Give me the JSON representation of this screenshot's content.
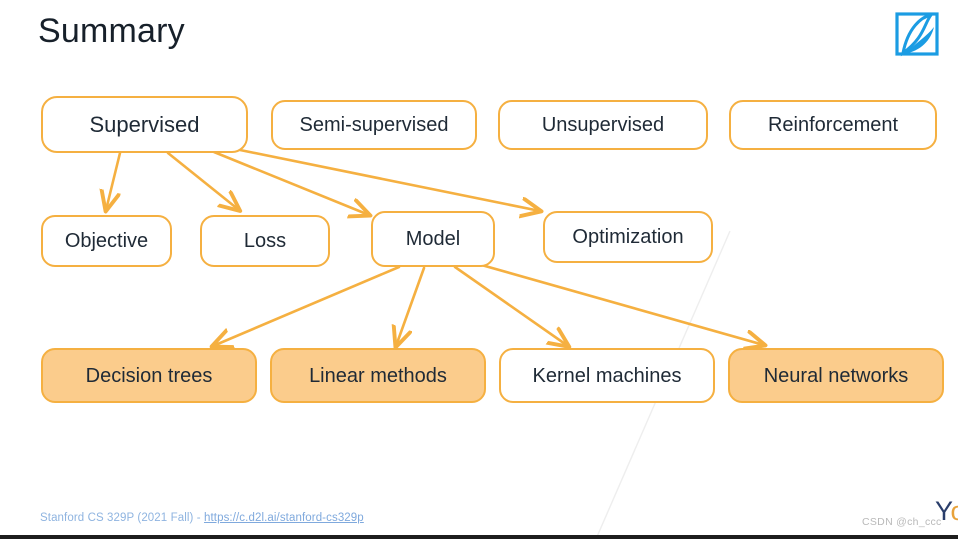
{
  "slide": {
    "title": "Summary",
    "logo_icon": "d2l-leaf-logo-icon",
    "background_color": "#ffffff",
    "accent_color": "#f5b041",
    "fill_color": "#fbcc8c",
    "text_color": "#1f2a36",
    "title_color": "#17202a"
  },
  "diagram": {
    "rows": {
      "paradigms": [
        {
          "id": "supervised",
          "label": "Supervised",
          "filled": false
        },
        {
          "id": "semi-supervised",
          "label": "Semi-supervised",
          "filled": false
        },
        {
          "id": "unsupervised",
          "label": "Unsupervised",
          "filled": false
        },
        {
          "id": "reinforcement",
          "label": "Reinforcement",
          "filled": false
        }
      ],
      "components": [
        {
          "id": "objective",
          "label": "Objective",
          "filled": false
        },
        {
          "id": "loss",
          "label": "Loss",
          "filled": false
        },
        {
          "id": "model",
          "label": "Model",
          "filled": false
        },
        {
          "id": "optimization",
          "label": "Optimization",
          "filled": false
        }
      ],
      "models": [
        {
          "id": "decision-trees",
          "label": "Decision trees",
          "filled": true
        },
        {
          "id": "linear-methods",
          "label": "Linear methods",
          "filled": true
        },
        {
          "id": "kernel-machines",
          "label": "Kernel machines",
          "filled": false
        },
        {
          "id": "neural-networks",
          "label": "Neural networks",
          "filled": true
        }
      ]
    },
    "edges": [
      {
        "from": "supervised",
        "to": "objective"
      },
      {
        "from": "supervised",
        "to": "loss"
      },
      {
        "from": "supervised",
        "to": "model"
      },
      {
        "from": "supervised",
        "to": "optimization"
      },
      {
        "from": "model",
        "to": "decision-trees"
      },
      {
        "from": "model",
        "to": "linear-methods"
      },
      {
        "from": "model",
        "to": "kernel-machines"
      },
      {
        "from": "model",
        "to": "neural-networks"
      }
    ]
  },
  "footer": {
    "prefix": "Stanford CS 329P (2021 Fall) - ",
    "link_text": "https://c.d2l.ai/stanford-cs329p"
  },
  "watermark": {
    "text": "CSDN @ch_ccc",
    "corner_letter": "Y",
    "corner_accent": "o"
  }
}
